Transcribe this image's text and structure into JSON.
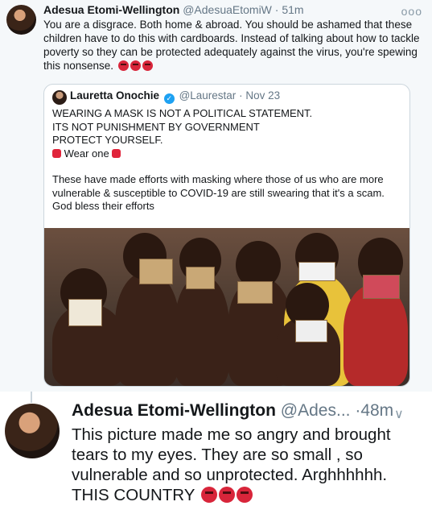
{
  "tweet1": {
    "author_name": "Adesua Etomi-Wellington",
    "handle": "@AdesuaEtomiW",
    "separator": "·",
    "time": "51m",
    "menu_glyph": "ooo",
    "text": "You are a disgrace. Both home & abroad. You should be ashamed that these children have to do this with cardboards. Instead of talking about how to tackle poverty so they can be protected adequately against the virus, you're spewing this nonsense.",
    "emojis": [
      "angry-face-icon",
      "angry-face-icon",
      "angry-face-icon"
    ]
  },
  "quoted": {
    "author_name": "Lauretta Onochie",
    "handle": "@Laurestar",
    "separator": "·",
    "date": "Nov 23",
    "verified_glyph": "✓",
    "line1": "WEARING A MASK IS NOT A POLITICAL STATEMENT.",
    "line2": "ITS NOT PUNISHMENT BY GOVERNMENT",
    "line3": "PROTECT YOURSELF.",
    "line4": "Wear one",
    "paragraph": "These have made efforts with masking where those of us who are more vulnerable & susceptible to COVID-19 are still swearing that it's a scam. God bless their efforts",
    "photo_icon": "children-with-cardboard-masks-photo"
  },
  "tweet2": {
    "author_name": "Adesua Etomi-Wellington",
    "handle": "@Ades...",
    "separator": "·",
    "time": "48m",
    "chevron": "∨",
    "text": "This picture made me so angry and brought tears to my eyes. They are so small , so vulnerable and so unprotected. Arghhhhhh. THIS COUNTRY",
    "emojis": [
      "angry-face-icon",
      "angry-face-icon",
      "angry-face-icon"
    ]
  },
  "colors": {
    "link_blue": "#1da1f2",
    "muted": "#657786",
    "angry_red": "#d8253a"
  }
}
